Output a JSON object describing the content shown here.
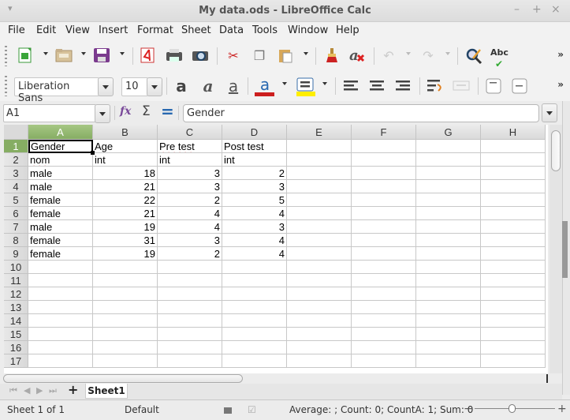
{
  "window": {
    "title": "My data.ods - LibreOffice Calc",
    "minimize": "–",
    "maximize": "+",
    "close": "×",
    "menu_arrow": "▾"
  },
  "menubar": [
    "File",
    "Edit",
    "View",
    "Insert",
    "Format",
    "Sheet",
    "Data",
    "Tools",
    "Window",
    "Help"
  ],
  "toolbar_standard": {
    "icons": [
      "new-spreadsheet-icon",
      "open-folder-icon",
      "save-icon",
      "export-pdf-icon",
      "print-icon",
      "print-preview-icon",
      "cut-icon",
      "copy-icon",
      "paste-icon",
      "clone-formatting-icon",
      "clear-formatting-icon",
      "undo-icon",
      "redo-icon",
      "find-replace-icon",
      "spellcheck-icon"
    ],
    "spellcheck_label": "Abc",
    "more": "»"
  },
  "toolbar_formatting": {
    "font_name": "Liberation Sans",
    "font_size": "10",
    "font_color": "#cc1f1f",
    "highlight_color": "#ffee00",
    "icons": [
      "bold-icon",
      "italic-icon",
      "underline-icon",
      "font-color-icon",
      "background-color-icon",
      "align-left-icon",
      "align-center-icon",
      "align-right-icon",
      "wrap-text-icon",
      "merge-cells-icon",
      "align-top-icon",
      "align-center-vertical-icon"
    ],
    "more": "»"
  },
  "formula_bar": {
    "name_box": "A1",
    "content": "Gender",
    "fx": "fx",
    "sum": "Σ",
    "equals": "="
  },
  "sheet": {
    "columns": [
      "A",
      "B",
      "C",
      "D",
      "E",
      "F",
      "G",
      "H"
    ],
    "selected_column": "A",
    "selected_row": "1",
    "rows": [
      "1",
      "2",
      "3",
      "4",
      "5",
      "6",
      "7",
      "8",
      "9",
      "10",
      "11",
      "12",
      "13",
      "14",
      "15",
      "16",
      "17"
    ],
    "cells": [
      [
        "Gender",
        "Age",
        "Pre test",
        "Post test"
      ],
      [
        "nom",
        "int",
        "int",
        "int"
      ],
      [
        "male",
        "18",
        "3",
        "2"
      ],
      [
        "male",
        "21",
        "3",
        "3"
      ],
      [
        "female",
        "22",
        "2",
        "5"
      ],
      [
        "female",
        "21",
        "4",
        "4"
      ],
      [
        "male",
        "19",
        "4",
        "3"
      ],
      [
        "female",
        "31",
        "3",
        "4"
      ],
      [
        "female",
        "19",
        "2",
        "4"
      ]
    ]
  },
  "tabs": {
    "nav_first": "⏮",
    "nav_prev": "◀",
    "nav_next": "▶",
    "nav_last": "⏭",
    "add": "+",
    "sheets": [
      "Sheet1"
    ]
  },
  "status": {
    "sheet_info": "Sheet 1 of 1",
    "page_style": "Default",
    "summary": "Average: ; Count: 0; CountA: 1; Sum: 0",
    "zoom_minus": "−",
    "zoom_plus": "+",
    "zoom_percent": 100
  }
}
